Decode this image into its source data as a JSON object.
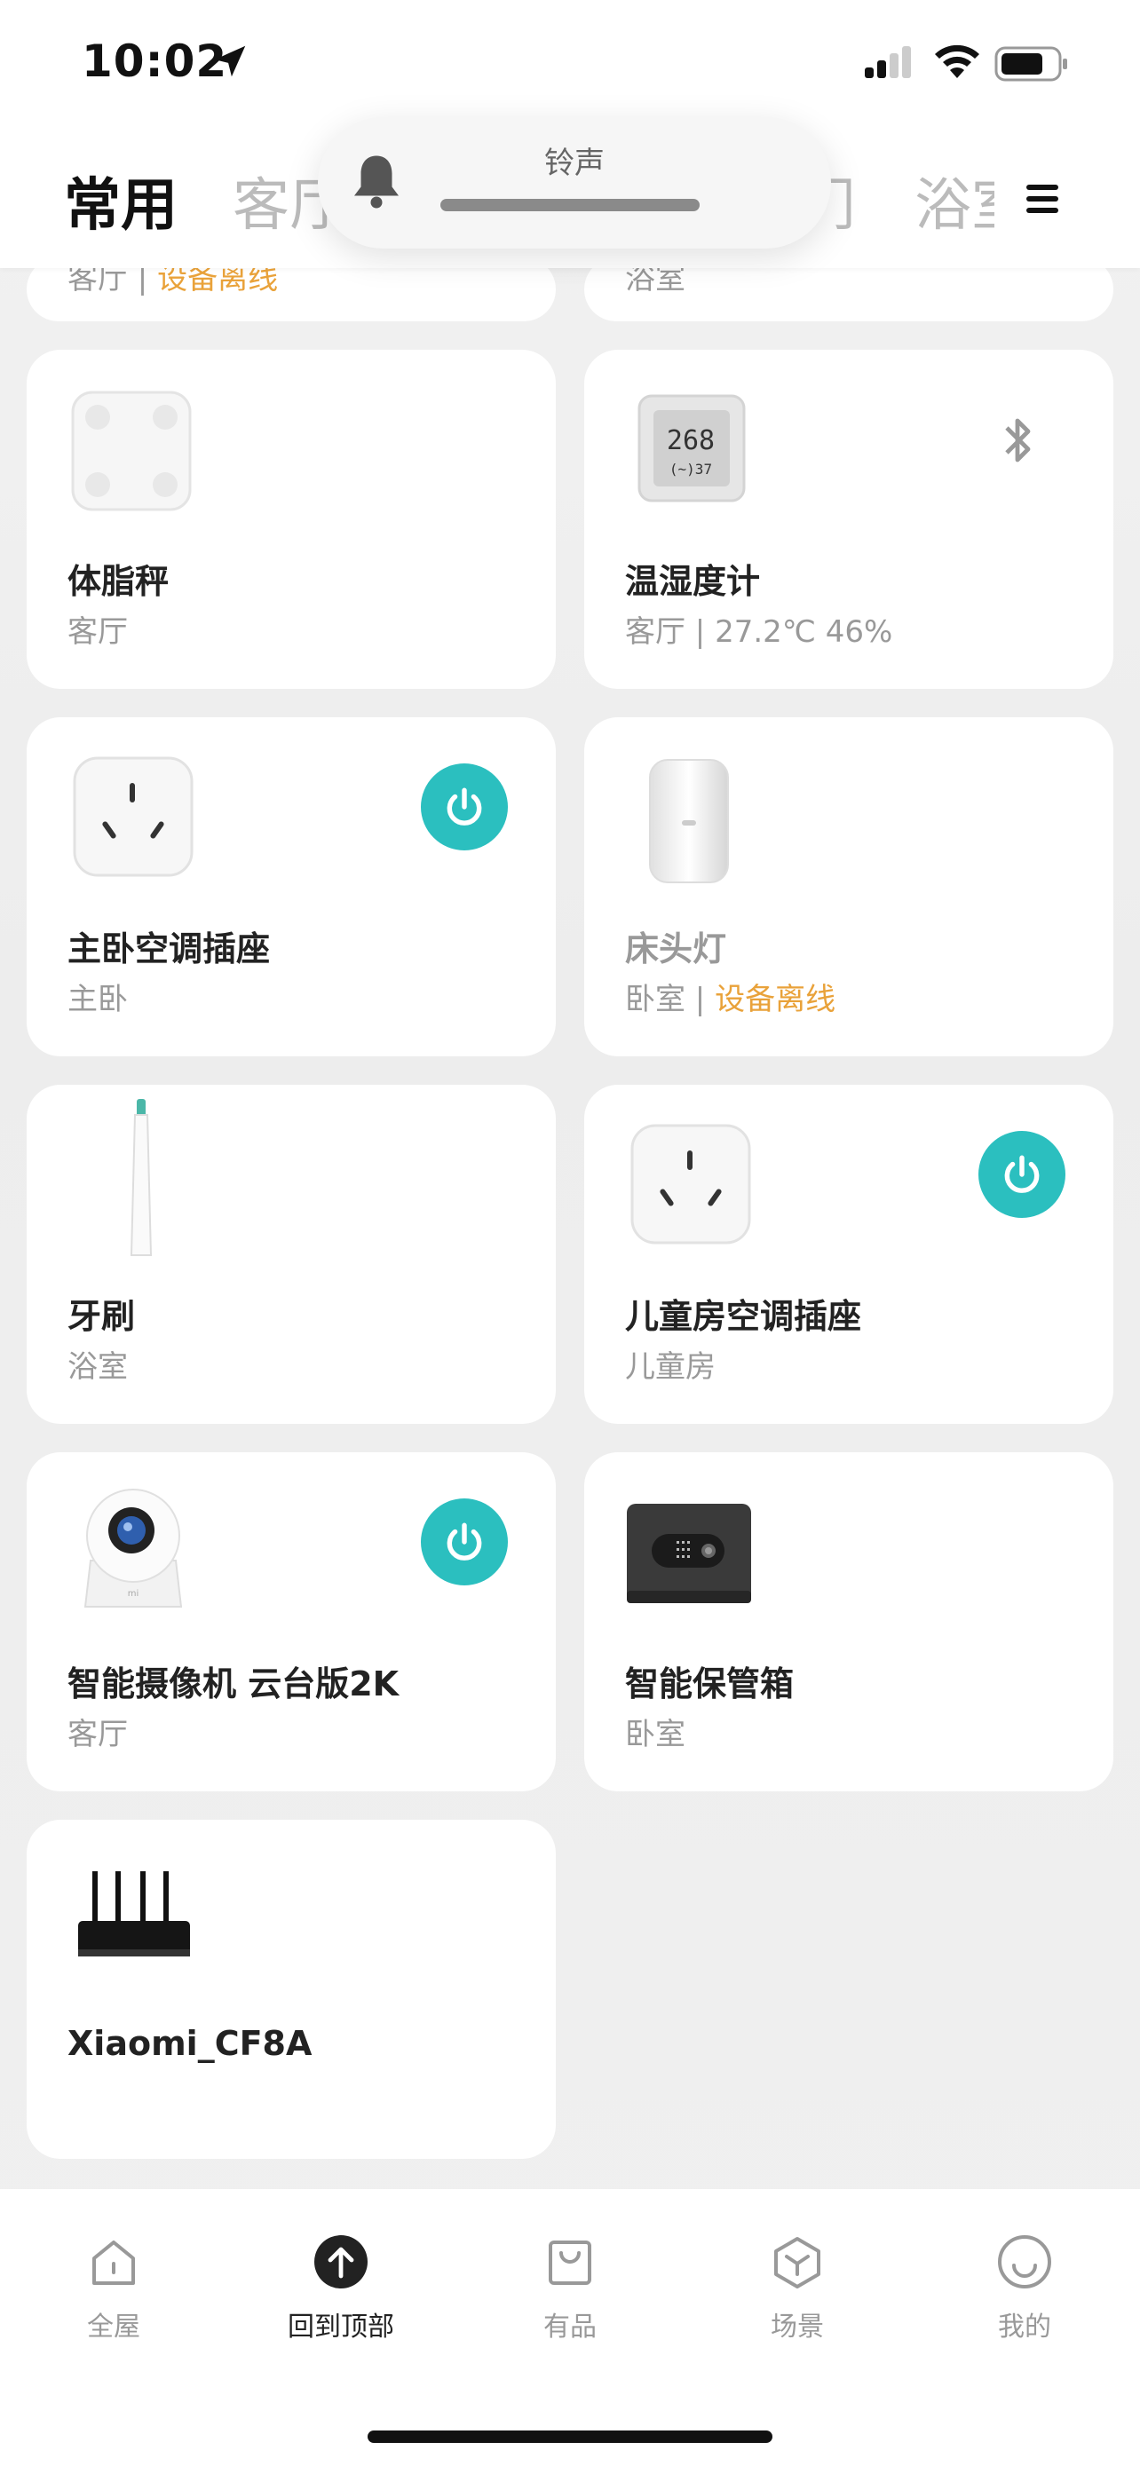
{
  "status_bar": {
    "time": "10:02"
  },
  "toast": {
    "label": "铃声",
    "volume_level": 0.45
  },
  "header": {
    "tabs": [
      "常用",
      "客厅",
      "门",
      "浴室"
    ]
  },
  "partial_cards": {
    "left": {
      "text_room": "客厅 | ",
      "text_status": "设备离线"
    },
    "right": {
      "text": "浴室"
    }
  },
  "devices": [
    {
      "name": "体脂秤",
      "room": "客厅",
      "icon": "scale-icon"
    },
    {
      "name": "温湿度计",
      "room": "客厅 | 27.2℃ 46%",
      "icon": "thermometer-icon",
      "bluetooth": true
    },
    {
      "name": "主卧空调插座",
      "room": "主卧",
      "icon": "socket-icon",
      "power": true
    },
    {
      "name": "床头灯",
      "room": "卧室 | ",
      "status": "设备离线",
      "icon": "lamp-icon",
      "offline": true
    },
    {
      "name": "牙刷",
      "room": "浴室",
      "icon": "toothbrush-icon"
    },
    {
      "name": "儿童房空调插座",
      "room": "儿童房",
      "icon": "socket-icon",
      "power": true
    },
    {
      "name": "智能摄像机 云台版2K",
      "room": "客厅",
      "icon": "camera-icon",
      "power": true
    },
    {
      "name": "智能保管箱",
      "room": "卧室",
      "icon": "safe-icon"
    },
    {
      "name": "Xiaomi_CF8A",
      "room": "",
      "icon": "router-icon"
    }
  ],
  "nav": [
    {
      "label": "全屋",
      "icon": "home-icon"
    },
    {
      "label": "回到顶部",
      "icon": "arrow-up-icon",
      "active": true
    },
    {
      "label": "有品",
      "icon": "bag-icon"
    },
    {
      "label": "场景",
      "icon": "cube-icon"
    },
    {
      "label": "我的",
      "icon": "smile-icon"
    }
  ],
  "colors": {
    "power": "#2bbfbf",
    "warning": "#e9a23a"
  }
}
